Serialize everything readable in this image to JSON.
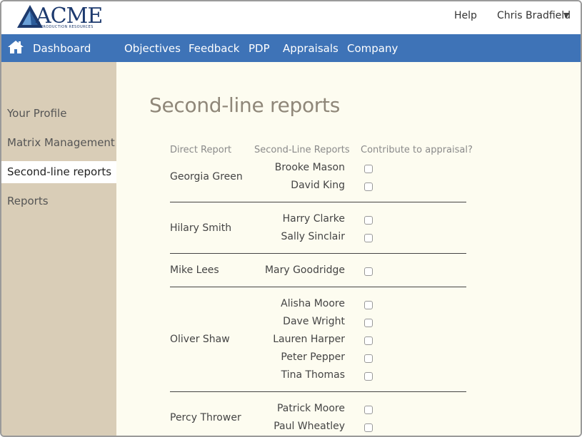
{
  "header": {
    "logo_text": "ACME",
    "logo_sub": "PRODUCTION RESOURCES",
    "help_label": "Help",
    "user_name": "Chris Bradfield"
  },
  "nav": {
    "dashboard": "Dashboard",
    "items": [
      "Objectives",
      "Feedback",
      "PDP",
      "Appraisals",
      "Company"
    ]
  },
  "sidebar": {
    "items": [
      "Your Profile",
      "Matrix Management",
      "Second-line reports",
      "Reports"
    ],
    "active_index": 2
  },
  "main": {
    "title": "Second-line reports",
    "columns": [
      "Direct Report",
      "Second-Line Reports",
      "Contribute to appraisal?"
    ],
    "groups": [
      {
        "direct_report": "Georgia Green",
        "second_line": [
          "Brooke Mason",
          "David King"
        ]
      },
      {
        "direct_report": "Hilary Smith",
        "second_line": [
          "Harry Clarke",
          "Sally Sinclair"
        ]
      },
      {
        "direct_report": "Mike Lees",
        "second_line": [
          "Mary Goodridge"
        ]
      },
      {
        "direct_report": "Oliver Shaw",
        "second_line": [
          "Alisha Moore",
          "Dave Wright",
          "Lauren Harper",
          "Peter Pepper",
          "Tina Thomas"
        ]
      },
      {
        "direct_report": "Percy Thrower",
        "second_line": [
          "Patrick Moore",
          "Paul Wheatley"
        ]
      }
    ]
  },
  "colors": {
    "nav_bg": "#3e73b7",
    "sidebar_bg": "#d9cdb7",
    "content_bg": "#fdfcf0",
    "logo": "#1d3a6e"
  },
  "icons": {
    "home": "home-icon",
    "caret": "caret-down-icon",
    "logo_mark": "triangle-logo-icon"
  }
}
